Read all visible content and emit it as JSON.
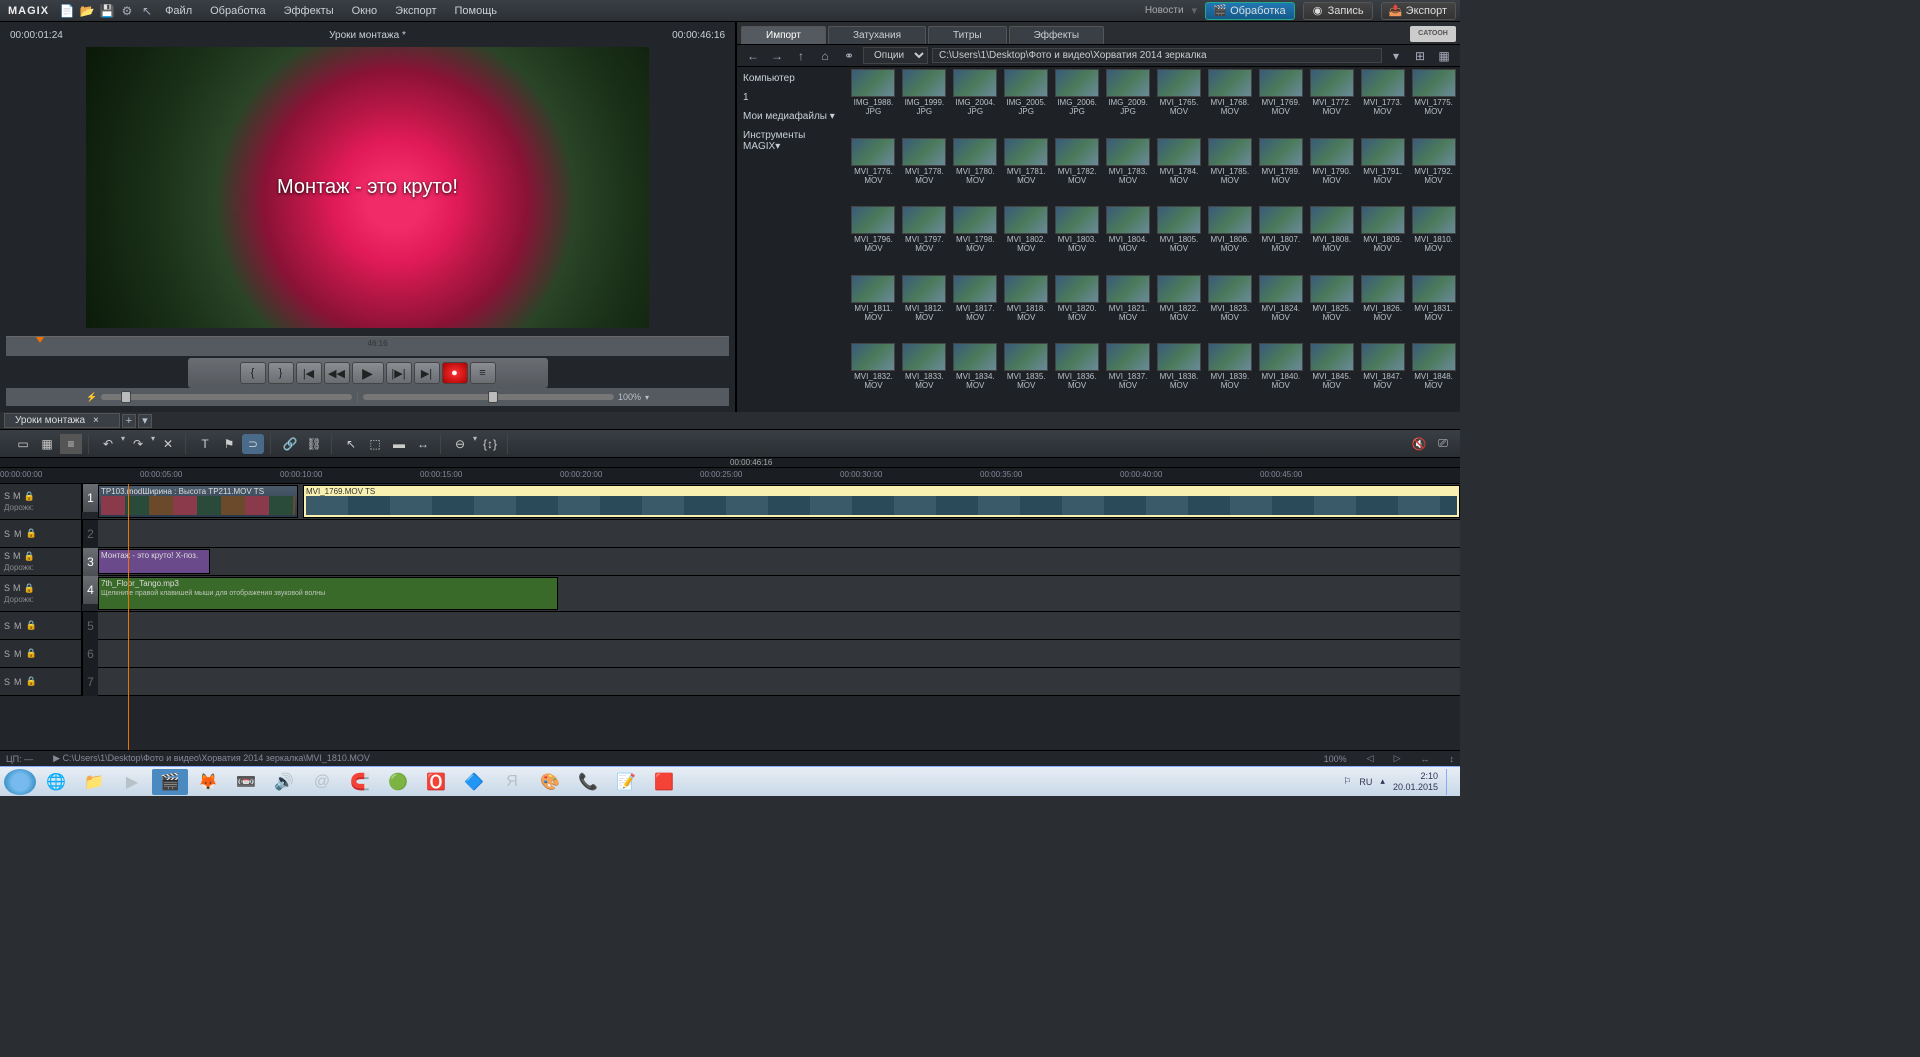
{
  "app": {
    "name": "MAGIX"
  },
  "menu": [
    "Файл",
    "Обработка",
    "Эффекты",
    "Окно",
    "Экспорт",
    "Помощь"
  ],
  "top_right": {
    "news": "Новости",
    "edit": "Обработка",
    "record": "Запись",
    "export": "Экспорт"
  },
  "preview": {
    "time_in": "00:00:01:24",
    "title": "Уроки монтажа *",
    "time_out": "00:00:46:16",
    "caption": "Монтаж - это круто!",
    "scrub_label": "46:16",
    "zoom": "100%"
  },
  "media": {
    "tabs": [
      "Импорт",
      "Затухания",
      "Титры",
      "Эффекты"
    ],
    "active_tab": 0,
    "opts_label": "Опции",
    "path": "C:\\Users\\1\\Desktop\\Фото и видео\\Хорватия 2014 зеркалка",
    "side": {
      "computer": "Компьютер",
      "one": "1",
      "mymedia": "Мои медиафайлы",
      "tools": "Инструменты MAGIX"
    },
    "files": [
      {
        "n": "IMG_1988.",
        "e": "JPG"
      },
      {
        "n": "IMG_1999.",
        "e": "JPG"
      },
      {
        "n": "IMG_2004.",
        "e": "JPG"
      },
      {
        "n": "IMG_2005.",
        "e": "JPG"
      },
      {
        "n": "IMG_2006.",
        "e": "JPG"
      },
      {
        "n": "IMG_2009.",
        "e": "JPG"
      },
      {
        "n": "MVI_1765.",
        "e": "MOV"
      },
      {
        "n": "MVI_1768.",
        "e": "MOV"
      },
      {
        "n": "MVI_1769.",
        "e": "MOV"
      },
      {
        "n": "MVI_1772.",
        "e": "MOV"
      },
      {
        "n": "MVI_1773.",
        "e": "MOV"
      },
      {
        "n": "MVI_1775.",
        "e": "MOV"
      },
      {
        "n": "MVI_1776.",
        "e": "MOV"
      },
      {
        "n": "MVI_1778.",
        "e": "MOV"
      },
      {
        "n": "MVI_1780.",
        "e": "MOV"
      },
      {
        "n": "MVI_1781.",
        "e": "MOV"
      },
      {
        "n": "MVI_1782.",
        "e": "MOV"
      },
      {
        "n": "MVI_1783.",
        "e": "MOV"
      },
      {
        "n": "MVI_1784.",
        "e": "MOV"
      },
      {
        "n": "MVI_1785.",
        "e": "MOV"
      },
      {
        "n": "MVI_1789.",
        "e": "MOV"
      },
      {
        "n": "MVI_1790.",
        "e": "MOV"
      },
      {
        "n": "MVI_1791.",
        "e": "MOV"
      },
      {
        "n": "MVI_1792.",
        "e": "MOV"
      },
      {
        "n": "MVI_1796.",
        "e": "MOV"
      },
      {
        "n": "MVI_1797.",
        "e": "MOV"
      },
      {
        "n": "MVI_1798.",
        "e": "MOV"
      },
      {
        "n": "MVI_1802.",
        "e": "MOV"
      },
      {
        "n": "MVI_1803.",
        "e": "MOV"
      },
      {
        "n": "MVI_1804.",
        "e": "MOV"
      },
      {
        "n": "MVI_1805.",
        "e": "MOV"
      },
      {
        "n": "MVI_1806.",
        "e": "MOV"
      },
      {
        "n": "MVI_1807.",
        "e": "MOV"
      },
      {
        "n": "MVI_1808.",
        "e": "MOV"
      },
      {
        "n": "MVI_1809.",
        "e": "MOV"
      },
      {
        "n": "MVI_1810.",
        "e": "MOV"
      },
      {
        "n": "MVI_1811.",
        "e": "MOV"
      },
      {
        "n": "MVI_1812.",
        "e": "MOV"
      },
      {
        "n": "MVI_1817.",
        "e": "MOV"
      },
      {
        "n": "MVI_1818.",
        "e": "MOV"
      },
      {
        "n": "MVI_1820.",
        "e": "MOV"
      },
      {
        "n": "MVI_1821.",
        "e": "MOV"
      },
      {
        "n": "MVI_1822.",
        "e": "MOV"
      },
      {
        "n": "MVI_1823.",
        "e": "MOV"
      },
      {
        "n": "MVI_1824.",
        "e": "MOV"
      },
      {
        "n": "MVI_1825.",
        "e": "MOV"
      },
      {
        "n": "MVI_1826.",
        "e": "MOV"
      },
      {
        "n": "MVI_1831.",
        "e": "MOV"
      },
      {
        "n": "MVI_1832.",
        "e": "MOV"
      },
      {
        "n": "MVI_1833.",
        "e": "MOV"
      },
      {
        "n": "MVI_1834.",
        "e": "MOV"
      },
      {
        "n": "MVI_1835.",
        "e": "MOV"
      },
      {
        "n": "MVI_1836.",
        "e": "MOV"
      },
      {
        "n": "MVI_1837.",
        "e": "MOV"
      },
      {
        "n": "MVI_1838.",
        "e": "MOV"
      },
      {
        "n": "MVI_1839.",
        "e": "MOV"
      },
      {
        "n": "MVI_1840.",
        "e": "MOV"
      },
      {
        "n": "MVI_1845.",
        "e": "MOV"
      },
      {
        "n": "MVI_1847.",
        "e": "MOV"
      },
      {
        "n": "MVI_1848.",
        "e": "MOV"
      }
    ]
  },
  "timeline": {
    "tab": "Уроки монтажа",
    "cur_time": "00:00:46:16",
    "ruler": [
      "00:00:00:00",
      "00:00:05:00",
      "00:00:10:00",
      "00:00:15:00",
      "00:00:20:00",
      "00:00:25:00",
      "00:00:30:00",
      "00:00:35:00",
      "00:00:40:00",
      "00:00:45:00"
    ],
    "tracks": {
      "t1": {
        "label": "Дорожк:",
        "clip1_label": "TP103.modШирина : Высота           TP211.MOV TS",
        "clip2_label": "MVI_1769.MOV TS"
      },
      "t3": {
        "label": "Дорожк:",
        "clip_label": "Монтаж - это круто!   X-поз."
      },
      "t4": {
        "label": "Дорожк:",
        "clip_label": "7th_Floor_Tango.mp3",
        "hint": "Щелкните правой клавишей мыши для отображения звуковой волны"
      }
    },
    "sm": {
      "s": "S",
      "m": "M"
    }
  },
  "status": {
    "left": "ЦП: —",
    "path": "▶ C:\\Users\\1\\Desktop\\Фото и видео\\Хорватия 2014 зеркалка\\MVI_1810.MOV",
    "zoom": "100%"
  },
  "taskbar": {
    "lang": "RU",
    "time": "2:10",
    "date": "20.01.2015"
  }
}
